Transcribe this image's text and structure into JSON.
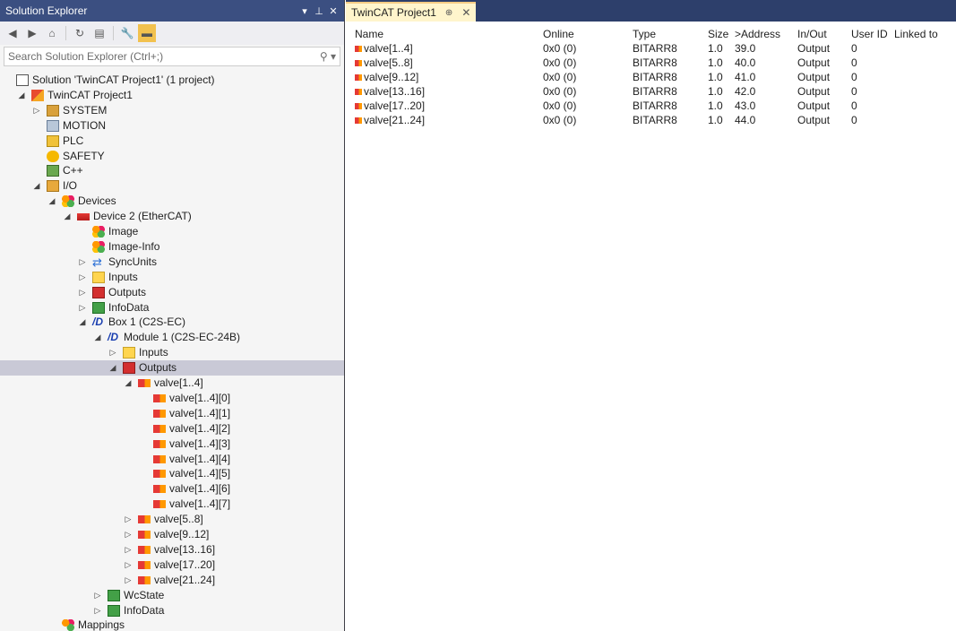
{
  "solution_explorer": {
    "title": "Solution Explorer",
    "title_buttons": [
      "▾",
      "⊥",
      "✕"
    ],
    "search_placeholder": "Search Solution Explorer (Ctrl+;)",
    "tree": [
      {
        "label": "Solution 'TwinCAT Project1' (1 project)",
        "icon": "solution-icon",
        "exp": "",
        "level": 0
      },
      {
        "label": "TwinCAT Project1",
        "icon": "project-icon",
        "exp": "◢",
        "level": 1
      },
      {
        "label": "SYSTEM",
        "icon": "system-icon",
        "exp": "▷",
        "level": 2
      },
      {
        "label": "MOTION",
        "icon": "motion-icon",
        "exp": "",
        "level": 2
      },
      {
        "label": "PLC",
        "icon": "plc-icon",
        "exp": "",
        "level": 2
      },
      {
        "label": "SAFETY",
        "icon": "safety-icon",
        "exp": "",
        "level": 2
      },
      {
        "label": "C++",
        "icon": "cpp-icon",
        "exp": "",
        "level": 2
      },
      {
        "label": "I/O",
        "icon": "io-icon",
        "exp": "◢",
        "level": 2
      },
      {
        "label": "Devices",
        "icon": "devices-icon",
        "exp": "◢",
        "level": 3
      },
      {
        "label": "Device 2 (EtherCAT)",
        "icon": "ethercat-device-icon",
        "exp": "◢",
        "level": 4
      },
      {
        "label": "Image",
        "icon": "image-icon",
        "exp": "",
        "level": 5
      },
      {
        "label": "Image-Info",
        "icon": "image-info-icon",
        "exp": "",
        "level": 5
      },
      {
        "label": "SyncUnits",
        "icon": "syncunits-icon",
        "exp": "▷",
        "level": 5
      },
      {
        "label": "Inputs",
        "icon": "inputs-icon",
        "exp": "▷",
        "level": 5
      },
      {
        "label": "Outputs",
        "icon": "outputs-icon",
        "exp": "▷",
        "level": 5
      },
      {
        "label": "InfoData",
        "icon": "infodata-icon",
        "exp": "▷",
        "level": 5
      },
      {
        "label": "Box 1 (C2S-EC)",
        "icon": "box-icon",
        "exp": "◢",
        "level": 5
      },
      {
        "label": "Module 1 (C2S-EC-24B)",
        "icon": "module-icon",
        "exp": "◢",
        "level": 6
      },
      {
        "label": "Inputs",
        "icon": "inputs-icon",
        "exp": "▷",
        "level": 7
      },
      {
        "label": "Outputs",
        "icon": "outputs-icon",
        "exp": "◢",
        "level": 7,
        "selected": true
      },
      {
        "label": "valve[1..4]",
        "icon": "variable-icon",
        "exp": "◢",
        "level": 8
      },
      {
        "label": "valve[1..4][0]",
        "icon": "variable-icon",
        "exp": "",
        "level": 9
      },
      {
        "label": "valve[1..4][1]",
        "icon": "variable-icon",
        "exp": "",
        "level": 9
      },
      {
        "label": "valve[1..4][2]",
        "icon": "variable-icon",
        "exp": "",
        "level": 9
      },
      {
        "label": "valve[1..4][3]",
        "icon": "variable-icon",
        "exp": "",
        "level": 9
      },
      {
        "label": "valve[1..4][4]",
        "icon": "variable-icon",
        "exp": "",
        "level": 9
      },
      {
        "label": "valve[1..4][5]",
        "icon": "variable-icon",
        "exp": "",
        "level": 9
      },
      {
        "label": "valve[1..4][6]",
        "icon": "variable-icon",
        "exp": "",
        "level": 9
      },
      {
        "label": "valve[1..4][7]",
        "icon": "variable-icon",
        "exp": "",
        "level": 9
      },
      {
        "label": "valve[5..8]",
        "icon": "variable-icon",
        "exp": "▷",
        "level": 8
      },
      {
        "label": "valve[9..12]",
        "icon": "variable-icon",
        "exp": "▷",
        "level": 8
      },
      {
        "label": "valve[13..16]",
        "icon": "variable-icon",
        "exp": "▷",
        "level": 8
      },
      {
        "label": "valve[17..20]",
        "icon": "variable-icon",
        "exp": "▷",
        "level": 8
      },
      {
        "label": "valve[21..24]",
        "icon": "variable-icon",
        "exp": "▷",
        "level": 8
      },
      {
        "label": "WcState",
        "icon": "wcstate-icon",
        "exp": "▷",
        "level": 6
      },
      {
        "label": "InfoData",
        "icon": "infodata-icon",
        "exp": "▷",
        "level": 6
      },
      {
        "label": "Mappings",
        "icon": "mappings-icon",
        "exp": "",
        "level": 3
      }
    ]
  },
  "document": {
    "tab_label": "TwinCAT Project1",
    "tab_pin": "⊕",
    "tab_close": "✕",
    "columns": [
      "Name",
      "Online",
      "Type",
      "Size",
      ">Address",
      "In/Out",
      "User ID",
      "Linked to"
    ],
    "rows": [
      {
        "name": "valve[1..4]",
        "online": "0x0 (0)",
        "type": "BITARR8",
        "size": "1.0",
        "address": "39.0",
        "inout": "Output",
        "userid": "0",
        "linked": ""
      },
      {
        "name": "valve[5..8]",
        "online": "0x0 (0)",
        "type": "BITARR8",
        "size": "1.0",
        "address": "40.0",
        "inout": "Output",
        "userid": "0",
        "linked": ""
      },
      {
        "name": "valve[9..12]",
        "online": "0x0 (0)",
        "type": "BITARR8",
        "size": "1.0",
        "address": "41.0",
        "inout": "Output",
        "userid": "0",
        "linked": ""
      },
      {
        "name": "valve[13..16]",
        "online": "0x0 (0)",
        "type": "BITARR8",
        "size": "1.0",
        "address": "42.0",
        "inout": "Output",
        "userid": "0",
        "linked": ""
      },
      {
        "name": "valve[17..20]",
        "online": "0x0 (0)",
        "type": "BITARR8",
        "size": "1.0",
        "address": "43.0",
        "inout": "Output",
        "userid": "0",
        "linked": ""
      },
      {
        "name": "valve[21..24]",
        "online": "0x0 (0)",
        "type": "BITARR8",
        "size": "1.0",
        "address": "44.0",
        "inout": "Output",
        "userid": "0",
        "linked": ""
      }
    ]
  }
}
